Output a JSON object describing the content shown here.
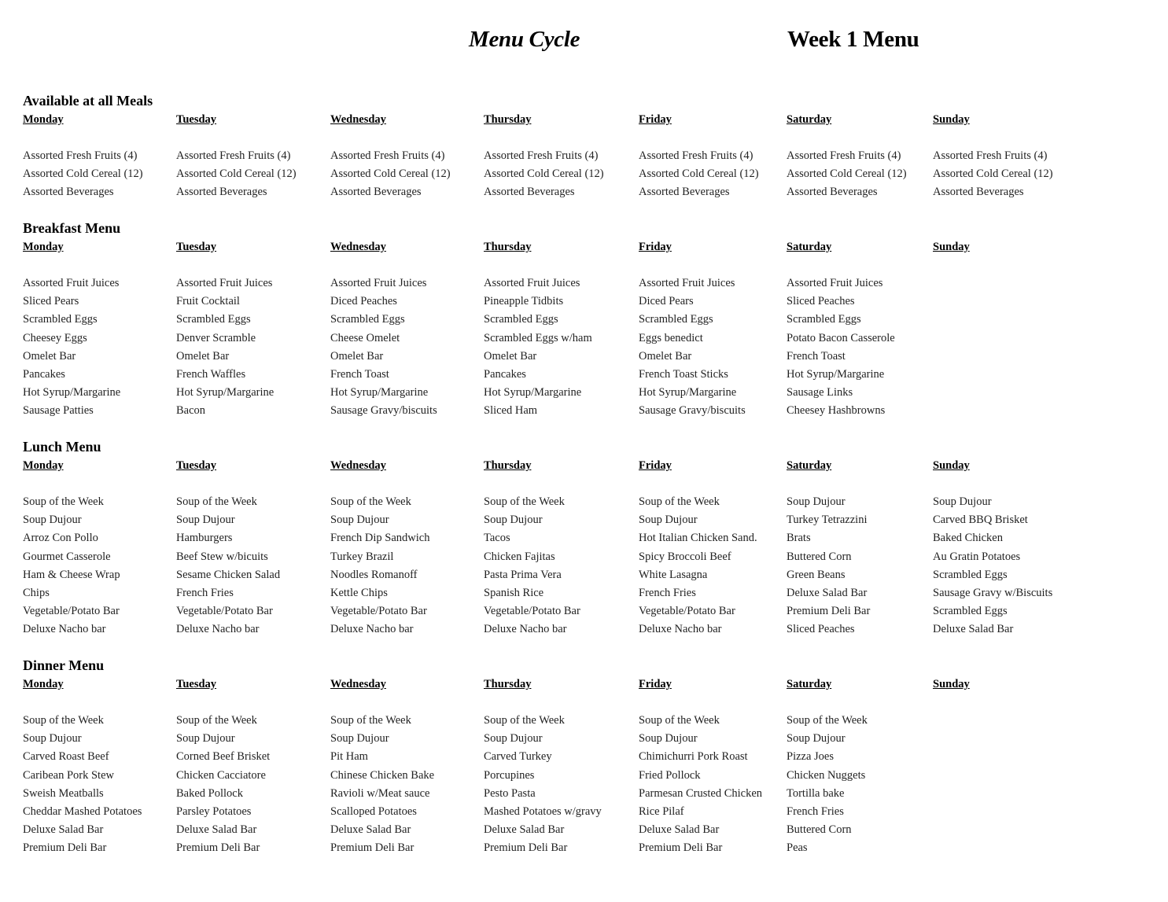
{
  "header": {
    "title": "Menu Cycle",
    "week": "Week 1 Menu"
  },
  "days": [
    "Monday",
    "Tuesday",
    "Wednesday",
    "Thursday",
    "Friday",
    "Saturday",
    "Sunday"
  ],
  "sections": [
    {
      "id": "avail",
      "title": "Available at all Meals",
      "columns": [
        [
          "Assorted Fresh Fruits (4)",
          "Assorted Cold Cereal (12)",
          "Assorted Beverages"
        ],
        [
          "Assorted Fresh Fruits (4)",
          "Assorted Cold Cereal (12)",
          "Assorted Beverages"
        ],
        [
          "Assorted Fresh Fruits (4)",
          "Assorted Cold Cereal (12)",
          "Assorted Beverages"
        ],
        [
          "Assorted Fresh Fruits (4)",
          "Assorted Cold Cereal (12)",
          "Assorted Beverages"
        ],
        [
          "Assorted Fresh Fruits (4)",
          "Assorted Cold Cereal (12)",
          "Assorted Beverages"
        ],
        [
          "Assorted Fresh Fruits (4)",
          "Assorted Cold Cereal (12)",
          "Assorted Beverages"
        ],
        [
          "Assorted Fresh Fruits (4)",
          "Assorted Cold Cereal (12)",
          "Assorted Beverages"
        ]
      ]
    },
    {
      "id": "breakfast",
      "title": "Breakfast Menu",
      "columns": [
        [
          "Assorted Fruit Juices",
          "Sliced Pears",
          "Scrambled Eggs",
          "Cheesey Eggs",
          "Omelet Bar",
          "Pancakes",
          "Hot Syrup/Margarine",
          "Sausage Patties"
        ],
        [
          "Assorted Fruit Juices",
          "Fruit Cocktail",
          "Scrambled Eggs",
          "Denver Scramble",
          "Omelet Bar",
          "French Waffles",
          "Hot Syrup/Margarine",
          "Bacon"
        ],
        [
          "Assorted Fruit Juices",
          "Diced Peaches",
          "Scrambled Eggs",
          "Cheese Omelet",
          "Omelet Bar",
          "French Toast",
          "Hot Syrup/Margarine",
          "Sausage Gravy/biscuits"
        ],
        [
          "Assorted Fruit Juices",
          "Pineapple Tidbits",
          "Scrambled Eggs",
          "Scrambled Eggs w/ham",
          "Omelet Bar",
          "Pancakes",
          "Hot Syrup/Margarine",
          "Sliced Ham"
        ],
        [
          "Assorted Fruit Juices",
          "Diced Pears",
          "Scrambled Eggs",
          "Eggs benedict",
          "Omelet Bar",
          "French Toast Sticks",
          "Hot Syrup/Margarine",
          "Sausage Gravy/biscuits"
        ],
        [
          "Assorted Fruit Juices",
          "Sliced Peaches",
          "Scrambled Eggs",
          "Potato Bacon Casserole",
          "French Toast",
          "Hot Syrup/Margarine",
          "Sausage Links",
          "Cheesey Hashbrowns"
        ],
        []
      ]
    },
    {
      "id": "lunch",
      "title": "Lunch Menu",
      "columns": [
        [
          "Soup of the Week",
          "Soup Dujour",
          "Arroz Con Pollo",
          "Gourmet Casserole",
          "Ham & Cheese Wrap",
          "Chips",
          "Vegetable/Potato Bar",
          "Deluxe Nacho bar"
        ],
        [
          "Soup of the Week",
          "Soup Dujour",
          "Hamburgers",
          "Beef Stew w/bicuits",
          "Sesame Chicken Salad",
          "French Fries",
          "Vegetable/Potato Bar",
          "Deluxe Nacho bar"
        ],
        [
          "Soup of the Week",
          "Soup Dujour",
          "French Dip Sandwich",
          "Turkey Brazil",
          "Noodles Romanoff",
          "Kettle Chips",
          "Vegetable/Potato Bar",
          "Deluxe Nacho bar"
        ],
        [
          "Soup of the Week",
          "Soup Dujour",
          "Tacos",
          "Chicken Fajitas",
          "Pasta Prima Vera",
          "Spanish Rice",
          "Vegetable/Potato Bar",
          "Deluxe Nacho bar"
        ],
        [
          "Soup of the Week",
          "Soup Dujour",
          "Hot Italian Chicken Sand.",
          "Spicy Broccoli Beef",
          "White Lasagna",
          "French Fries",
          "Vegetable/Potato Bar",
          "Deluxe Nacho bar"
        ],
        [
          "Soup Dujour",
          "Turkey Tetrazzini",
          "Brats",
          "Buttered Corn",
          "Green Beans",
          "Deluxe Salad Bar",
          "Premium Deli Bar",
          "Sliced Peaches"
        ],
        [
          "Soup Dujour",
          "Carved BBQ Brisket",
          "Baked Chicken",
          "Au Gratin Potatoes",
          "Scrambled Eggs",
          "Sausage Gravy w/Biscuits",
          "Scrambled Eggs",
          "Deluxe Salad Bar"
        ]
      ]
    },
    {
      "id": "dinner",
      "title": "Dinner Menu",
      "columns": [
        [
          "Soup of the Week",
          "Soup Dujour",
          "Carved Roast Beef",
          "Caribean Pork Stew",
          "Sweish Meatballs",
          "Cheddar Mashed Potatoes",
          "Deluxe Salad Bar",
          "Premium Deli Bar"
        ],
        [
          "Soup of the Week",
          "Soup Dujour",
          "Corned Beef Brisket",
          "Chicken Cacciatore",
          "Baked Pollock",
          "Parsley Potatoes",
          "Deluxe Salad Bar",
          "Premium Deli Bar"
        ],
        [
          "Soup of the Week",
          "Soup Dujour",
          "Pit Ham",
          "Chinese Chicken Bake",
          "Ravioli w/Meat sauce",
          "Scalloped Potatoes",
          "Deluxe Salad Bar",
          "Premium Deli Bar"
        ],
        [
          "Soup of the Week",
          "Soup Dujour",
          "Carved Turkey",
          "Porcupines",
          "Pesto Pasta",
          "Mashed Potatoes w/gravy",
          "Deluxe Salad Bar",
          "Premium Deli Bar"
        ],
        [
          "Soup of the Week",
          "Soup Dujour",
          "Chimichurri Pork Roast",
          "Fried Pollock",
          "Parmesan Crusted Chicken",
          "Rice Pilaf",
          "Deluxe Salad Bar",
          "Premium Deli Bar"
        ],
        [
          "Soup of the Week",
          "Soup Dujour",
          "Pizza Joes",
          "Chicken Nuggets",
          "Tortilla bake",
          "French Fries",
          "Buttered Corn",
          "Peas"
        ],
        []
      ]
    }
  ]
}
